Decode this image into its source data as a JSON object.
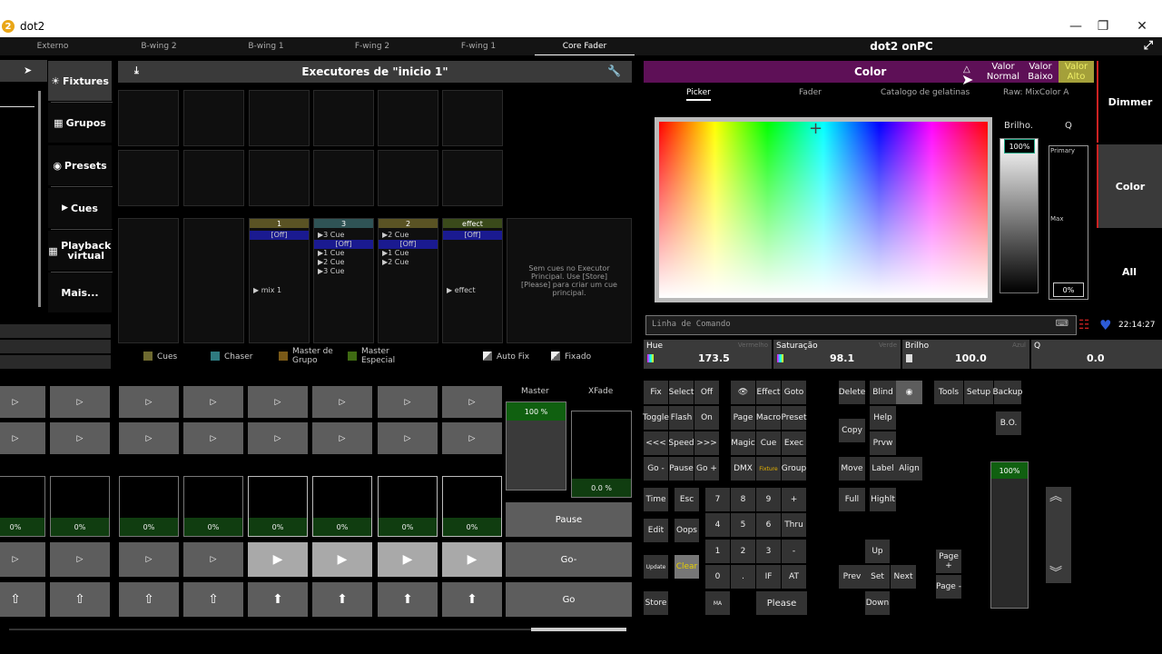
{
  "window": {
    "title": "dot2",
    "logo": "2"
  },
  "tabs": [
    "Externo",
    "B-wing 2",
    "B-wing 1",
    "F-wing 2",
    "F-wing 1",
    "Core Fader"
  ],
  "header": {
    "title": "dot2 onPC"
  },
  "sidebar": {
    "items": [
      "Fixtures",
      "Grupos",
      "Presets",
      "Cues",
      "Playback virtual",
      "Mais..."
    ]
  },
  "executors": {
    "title": "Executores de \"inicio 1\"",
    "cols": [
      {
        "head": "1",
        "status": "[Off]",
        "cues": [],
        "label": "mix 1",
        "color": "#5a5324"
      },
      {
        "head": "3",
        "status": "[Off]",
        "cues": [
          "3  Cue",
          "1  Cue",
          "2  Cue",
          "3  Cue"
        ],
        "label": "",
        "color": "#2f5355"
      },
      {
        "head": "2",
        "status": "[Off]",
        "cues": [
          "2  Cue",
          "1  Cue",
          "2  Cue"
        ],
        "label": "",
        "color": "#5a5324"
      },
      {
        "head": "effect",
        "status": "[Off]",
        "cues": [],
        "label": "effect",
        "color": "#3a4a1a"
      }
    ],
    "message": "Sem cues no Executor Principal. Use [Store][Please] para criar um cue principal."
  },
  "legend": [
    {
      "label": "Cues",
      "color": "#6e6a30"
    },
    {
      "label": "Chaser",
      "color": "#2f7a80"
    },
    {
      "label": "Master de Grupo",
      "color": "#7a5a18"
    },
    {
      "label": "Master Especial",
      "color": "#3f6a12"
    },
    {
      "label": "Auto Fix",
      "color": "#dddddd"
    },
    {
      "label": "Fixado",
      "color": "#dddddd"
    }
  ],
  "faders": {
    "levels": [
      "0%",
      "0%",
      "0%",
      "0%",
      "0%",
      "0%",
      "0%",
      "0%"
    ],
    "master_label": "Master",
    "master_value": "100 %",
    "xfade_label": "XFade",
    "xfade_value": "0.0 %",
    "pause": "Pause",
    "go_minus": "Go-",
    "go": "Go"
  },
  "color": {
    "title": "Color",
    "valor_normal": "Valor Normal",
    "valor_baixo": "Valor Baixo",
    "valor_alto": "Valor Alto",
    "tabs": [
      "Picker",
      "Fader",
      "Catalogo de gelatinas",
      "Raw: MixColor A"
    ],
    "brilho_label": "Brilho.",
    "q_label": "Q",
    "brilho_value": "100%",
    "primary": "Primary",
    "max": "Max",
    "q_value": "0%"
  },
  "right_tabs": [
    "Dimmer",
    "Color",
    "All"
  ],
  "command": {
    "placeholder": "Linha de Comando",
    "time": "22:14:27"
  },
  "params": [
    {
      "name": "Hue",
      "hint": "Vermelho",
      "value": "173.5"
    },
    {
      "name": "Saturação",
      "hint": "Verde",
      "value": "98.1"
    },
    {
      "name": "Brilho",
      "hint": "Azul",
      "value": "100.0"
    },
    {
      "name": "Q",
      "hint": "",
      "value": "0.0"
    }
  ],
  "keys": {
    "fix": "Fix",
    "select": "Select",
    "off": "Off",
    "effect": "Effect",
    "goto": "Goto",
    "toggle": "Toggle",
    "flash": "Flash",
    "on": "On",
    "page": "Page",
    "macro": "Macro",
    "preset": "Preset",
    "back": "<<<",
    "speed": "Speed",
    "fwd": ">>>",
    "magic": "Magic",
    "cue": "Cue",
    "exec": "Exec",
    "gominus": "Go -",
    "pause": "Pause",
    "goplus": "Go +",
    "dmx": "DMX",
    "fixture": "Fixture",
    "group": "Group",
    "time": "Time",
    "esc": "Esc",
    "edit": "Edit",
    "oops": "Oops",
    "update": "Update",
    "clear": "Clear",
    "store": "Store",
    "ma": "MA",
    "n7": "7",
    "n8": "8",
    "n9": "9",
    "plus": "+",
    "n4": "4",
    "n5": "5",
    "n6": "6",
    "thru": "Thru",
    "n1": "1",
    "n2": "2",
    "n3": "3",
    "minus": "-",
    "n0": "0",
    "dot": ".",
    "if": "IF",
    "at": "AT",
    "please": "Please",
    "delete": "Delete",
    "blind": "Blind",
    "copy": "Copy",
    "help": "Help",
    "prvw": "Prvw",
    "move": "Move",
    "label": "Label",
    "align": "Align",
    "full": "Full",
    "highlt": "Highlt",
    "tools": "Tools",
    "setup": "Setup",
    "backup": "Backup",
    "bo": "B.O.",
    "up": "Up",
    "prev": "Prev",
    "set": "Set",
    "next": "Next",
    "down": "Down",
    "pageplus": "Page +",
    "pageminus": "Page -",
    "grandmaster": "100%"
  }
}
